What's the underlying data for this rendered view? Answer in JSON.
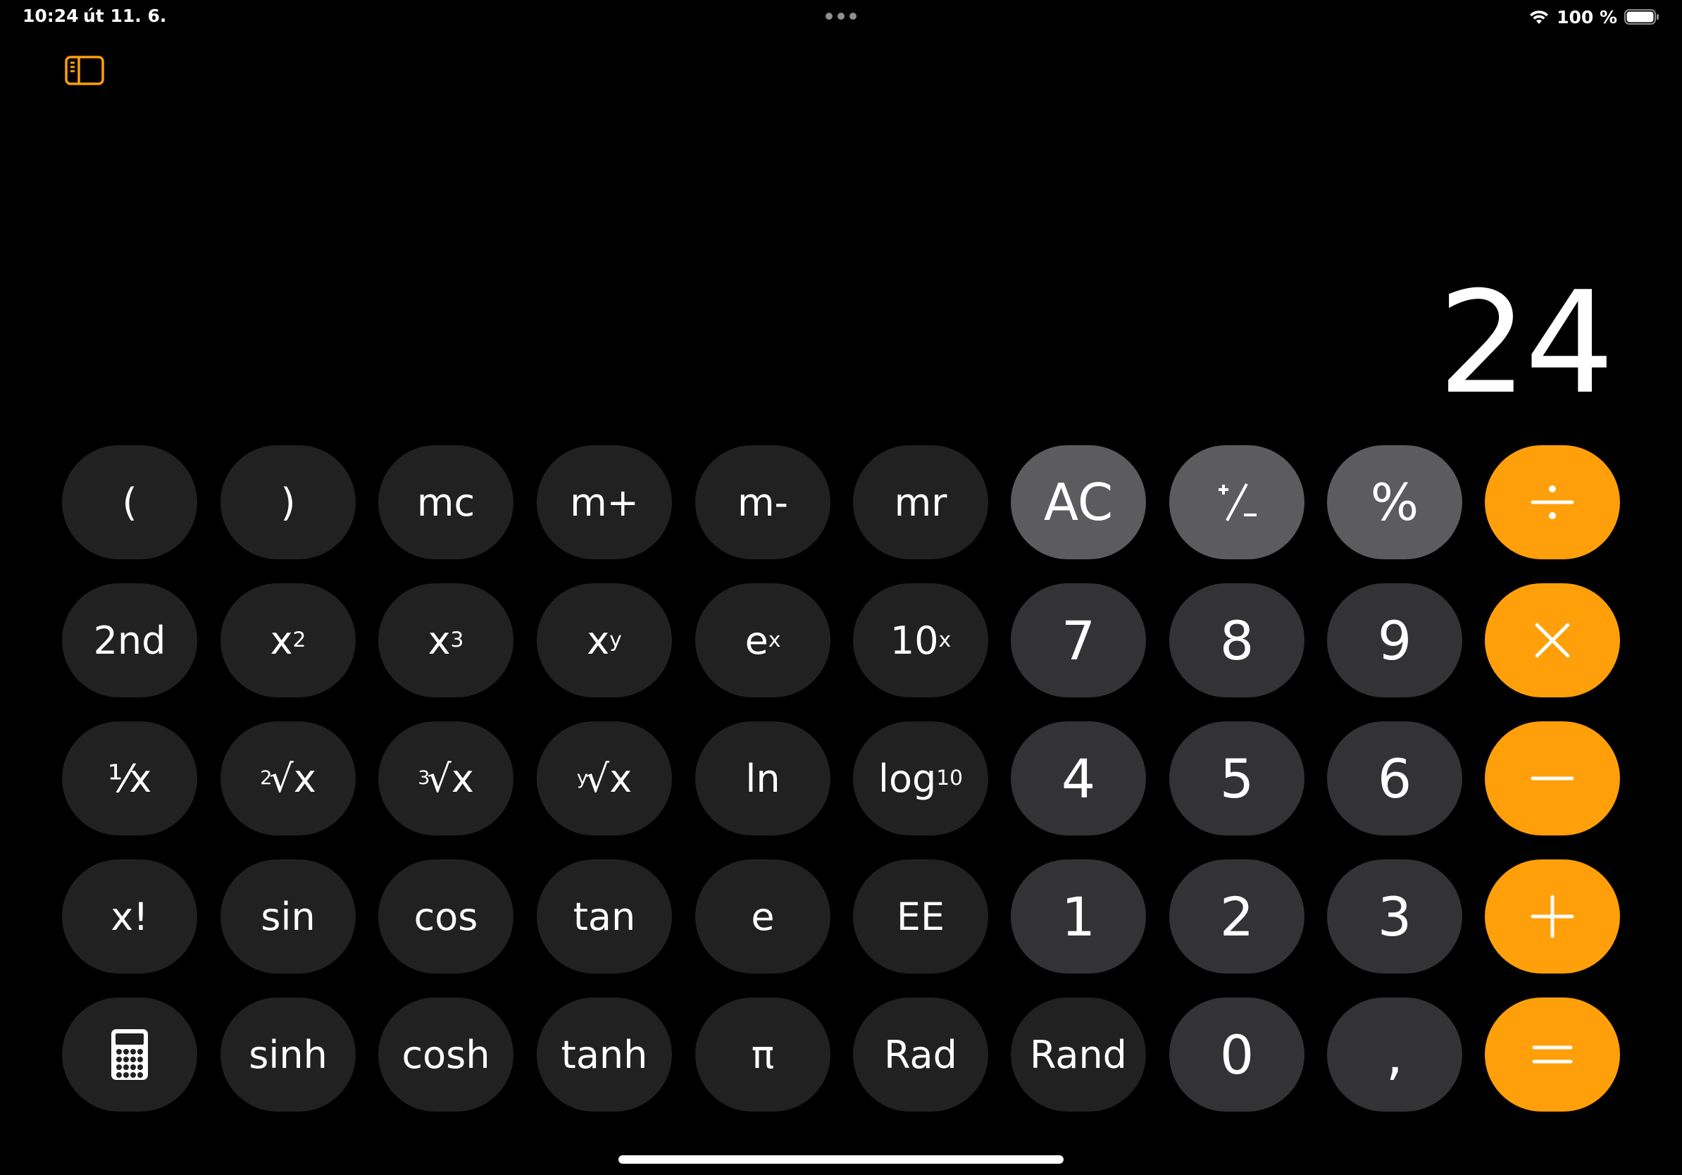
{
  "status_bar": {
    "time": "10:24",
    "date": "út 11. 6.",
    "battery_percent": "100 %",
    "battery_level": 1.0,
    "wifi_icon": "wifi-icon",
    "battery_icon": "battery-icon"
  },
  "toolbar": {
    "sidebar_icon": "sidebar-icon",
    "accent_color": "#ff9f0a"
  },
  "display": {
    "value": "24"
  },
  "colors": {
    "background": "#000000",
    "key_scientific": "#212121",
    "key_digit": "#333335",
    "key_function": "#5c5c5e",
    "key_operator": "#ff9f0a",
    "text": "#ffffff"
  },
  "keys": {
    "row1": {
      "open_paren": "(",
      "close_paren": ")",
      "mc": "mc",
      "m_plus": "m+",
      "m_minus": "m-",
      "mr": "mr",
      "ac": "AC",
      "plus_minus_icon": "plus-minus-icon",
      "percent": "%",
      "divide_icon": "divide-icon"
    },
    "row2": {
      "second": "2nd",
      "x_squared_base": "x",
      "x_squared_exp": "2",
      "x_cubed_base": "x",
      "x_cubed_exp": "3",
      "x_y_base": "x",
      "x_y_exp": "y",
      "e_x_base": "e",
      "e_x_exp": "x",
      "ten_x_base": "10",
      "ten_x_exp": "x",
      "seven": "7",
      "eight": "8",
      "nine": "9",
      "multiply_icon": "multiply-icon"
    },
    "row3": {
      "reciprocal": "¹⁄x",
      "sqrt_index": "2",
      "sqrt_radicand": "√x",
      "cbrt_index": "3",
      "cbrt_radicand": "√x",
      "yroot_index": "y",
      "yroot_radicand": "√x",
      "ln": "ln",
      "log_base": "log",
      "log_sub": "10",
      "four": "4",
      "five": "5",
      "six": "6",
      "minus_icon": "minus-icon"
    },
    "row4": {
      "factorial": "x!",
      "sin": "sin",
      "cos": "cos",
      "tan": "tan",
      "e": "e",
      "ee": "EE",
      "one": "1",
      "two": "2",
      "three": "3",
      "plus_icon": "plus-icon"
    },
    "row5": {
      "calculator_icon": "calculator-icon",
      "sinh": "sinh",
      "cosh": "cosh",
      "tanh": "tanh",
      "pi": "π",
      "rad": "Rad",
      "rand": "Rand",
      "zero": "0",
      "decimal": ",",
      "equals_icon": "equals-icon"
    }
  }
}
